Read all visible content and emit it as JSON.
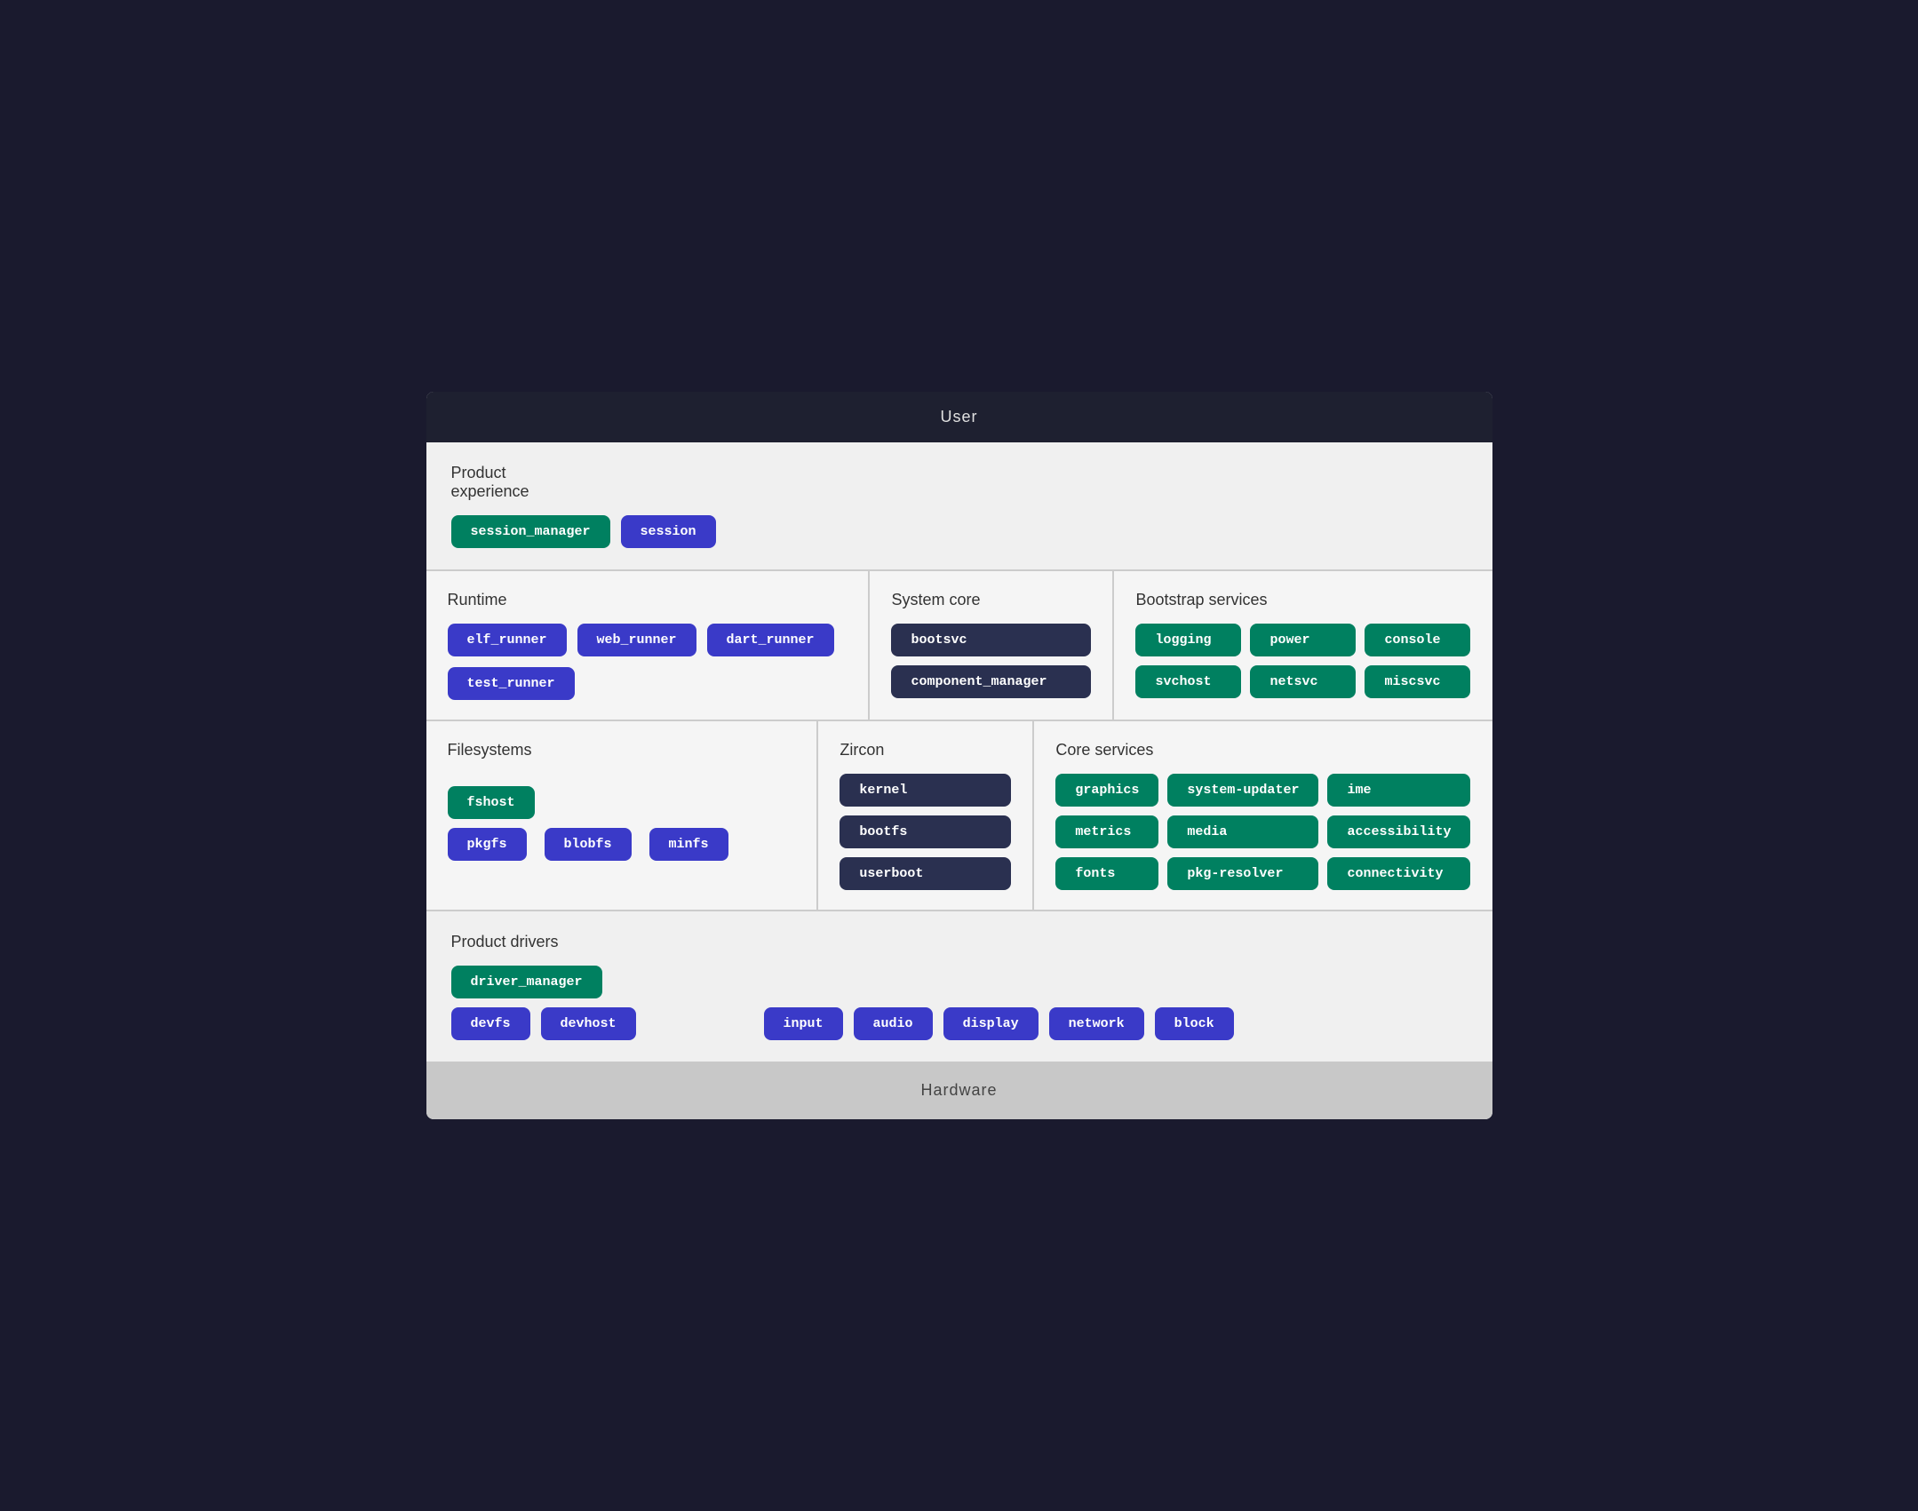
{
  "user_bar": {
    "label": "User"
  },
  "hardware_bar": {
    "label": "Hardware"
  },
  "product_experience": {
    "label": "Product\nexperience",
    "chips": [
      {
        "id": "session_manager",
        "text": "session_manager",
        "color": "green"
      },
      {
        "id": "session",
        "text": "session",
        "color": "blue"
      }
    ]
  },
  "runtime": {
    "label": "Runtime",
    "chips": [
      {
        "id": "elf_runner",
        "text": "elf_runner",
        "color": "blue"
      },
      {
        "id": "web_runner",
        "text": "web_runner",
        "color": "blue"
      },
      {
        "id": "dart_runner",
        "text": "dart_runner",
        "color": "blue"
      },
      {
        "id": "test_runner",
        "text": "test_runner",
        "color": "blue"
      }
    ]
  },
  "system_core": {
    "label": "System core",
    "chips": [
      {
        "id": "bootsvc",
        "text": "bootsvc",
        "color": "dark"
      },
      {
        "id": "component_manager",
        "text": "component_manager",
        "color": "dark"
      }
    ]
  },
  "bootstrap_services": {
    "label": "Bootstrap services",
    "chips": [
      {
        "id": "logging",
        "text": "logging",
        "color": "green"
      },
      {
        "id": "power",
        "text": "power",
        "color": "green"
      },
      {
        "id": "console",
        "text": "console",
        "color": "green"
      },
      {
        "id": "svchost",
        "text": "svchost",
        "color": "green"
      },
      {
        "id": "netsvc",
        "text": "netsvc",
        "color": "green"
      },
      {
        "id": "miscsvc",
        "text": "miscsvc",
        "color": "green"
      }
    ]
  },
  "filesystems": {
    "label": "Filesystems",
    "chips": [
      {
        "id": "fshost",
        "text": "fshost",
        "color": "green"
      },
      {
        "id": "pkgfs",
        "text": "pkgfs",
        "color": "blue"
      },
      {
        "id": "blobfs",
        "text": "blobfs",
        "color": "blue"
      },
      {
        "id": "minfs",
        "text": "minfs",
        "color": "blue"
      }
    ]
  },
  "zircon": {
    "label": "Zircon",
    "chips": [
      {
        "id": "kernel",
        "text": "kernel",
        "color": "dark"
      },
      {
        "id": "bootfs",
        "text": "bootfs",
        "color": "dark"
      },
      {
        "id": "userboot",
        "text": "userboot",
        "color": "dark"
      }
    ]
  },
  "core_services": {
    "label": "Core services",
    "chips": [
      {
        "id": "graphics",
        "text": "graphics",
        "color": "green"
      },
      {
        "id": "system-updater",
        "text": "system-updater",
        "color": "green"
      },
      {
        "id": "ime",
        "text": "ime",
        "color": "green"
      },
      {
        "id": "metrics",
        "text": "metrics",
        "color": "green"
      },
      {
        "id": "media",
        "text": "media",
        "color": "green"
      },
      {
        "id": "accessibility",
        "text": "accessibility",
        "color": "green"
      },
      {
        "id": "fonts",
        "text": "fonts",
        "color": "green"
      },
      {
        "id": "pkg-resolver",
        "text": "pkg-resolver",
        "color": "green"
      },
      {
        "id": "connectivity",
        "text": "connectivity",
        "color": "green"
      }
    ]
  },
  "product_drivers": {
    "label": "Product drivers",
    "chips": [
      {
        "id": "driver_manager",
        "text": "driver_manager",
        "color": "green"
      },
      {
        "id": "devfs",
        "text": "devfs",
        "color": "blue"
      },
      {
        "id": "devhost",
        "text": "devhost",
        "color": "blue"
      },
      {
        "id": "input",
        "text": "input",
        "color": "blue"
      },
      {
        "id": "audio",
        "text": "audio",
        "color": "blue"
      },
      {
        "id": "display",
        "text": "display",
        "color": "blue"
      },
      {
        "id": "network",
        "text": "network",
        "color": "blue"
      },
      {
        "id": "block",
        "text": "block",
        "color": "blue"
      }
    ]
  }
}
